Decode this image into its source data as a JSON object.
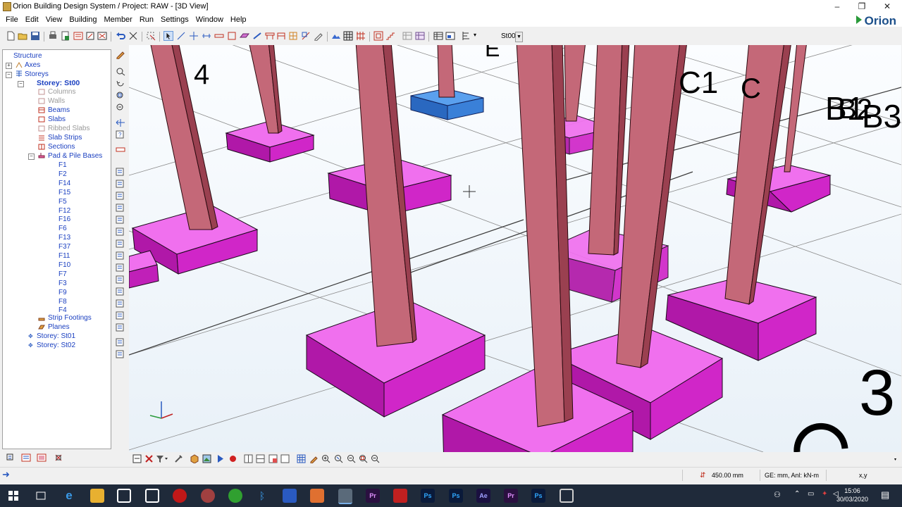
{
  "window": {
    "title": "Orion Building Design System / Project: RAW - [3D View]",
    "controls": [
      "–",
      "❐",
      "✕"
    ]
  },
  "menu": [
    "File",
    "Edit",
    "View",
    "Building",
    "Member",
    "Run",
    "Settings",
    "Window",
    "Help"
  ],
  "brand": "Orion",
  "toolbar": {
    "storey_value": "St00"
  },
  "tree": {
    "root": "Structure",
    "axes": "Axes",
    "storeys": "Storeys",
    "current_storey": "Storey: St00",
    "members": [
      {
        "label": "Columns",
        "state": "gray"
      },
      {
        "label": "Walls",
        "state": "gray"
      },
      {
        "label": "Beams",
        "state": "active"
      },
      {
        "label": "Slabs",
        "state": "active"
      },
      {
        "label": "Ribbed Slabs",
        "state": "gray"
      },
      {
        "label": "Slab Strips",
        "state": "active"
      },
      {
        "label": "Sections",
        "state": "active"
      }
    ],
    "pad_bases": "Pad & Pile Bases",
    "footings": [
      "F1",
      "F2",
      "F14",
      "F15",
      "F5",
      "F12",
      "F16",
      "F6",
      "F13",
      "F37",
      "F11",
      "F10",
      "F7",
      "F3",
      "F9",
      "F8",
      "F4"
    ],
    "strip_footings": "Strip Footings",
    "planes": "Planes",
    "other_storeys": [
      "Storey: St01",
      "Storey: St02"
    ]
  },
  "viewport": {
    "axis_labels": [
      "4",
      "C1",
      "B3",
      "3",
      "C",
      "B1",
      "B2",
      "E"
    ],
    "colors": {
      "column": "#c0606e",
      "pad": "#e020d8",
      "selected_pad": "#3a88e0",
      "grid": "#555555"
    }
  },
  "status": {
    "dimension": "450.00 mm",
    "units": "GE: mm, Anl: kN-m",
    "coords": "x,y"
  },
  "taskbar": {
    "time": "15:06",
    "date": "30/03/2020",
    "apps": [
      "Pr",
      "Ps",
      "Ps",
      "Ae",
      "Pr",
      "Ps"
    ]
  }
}
